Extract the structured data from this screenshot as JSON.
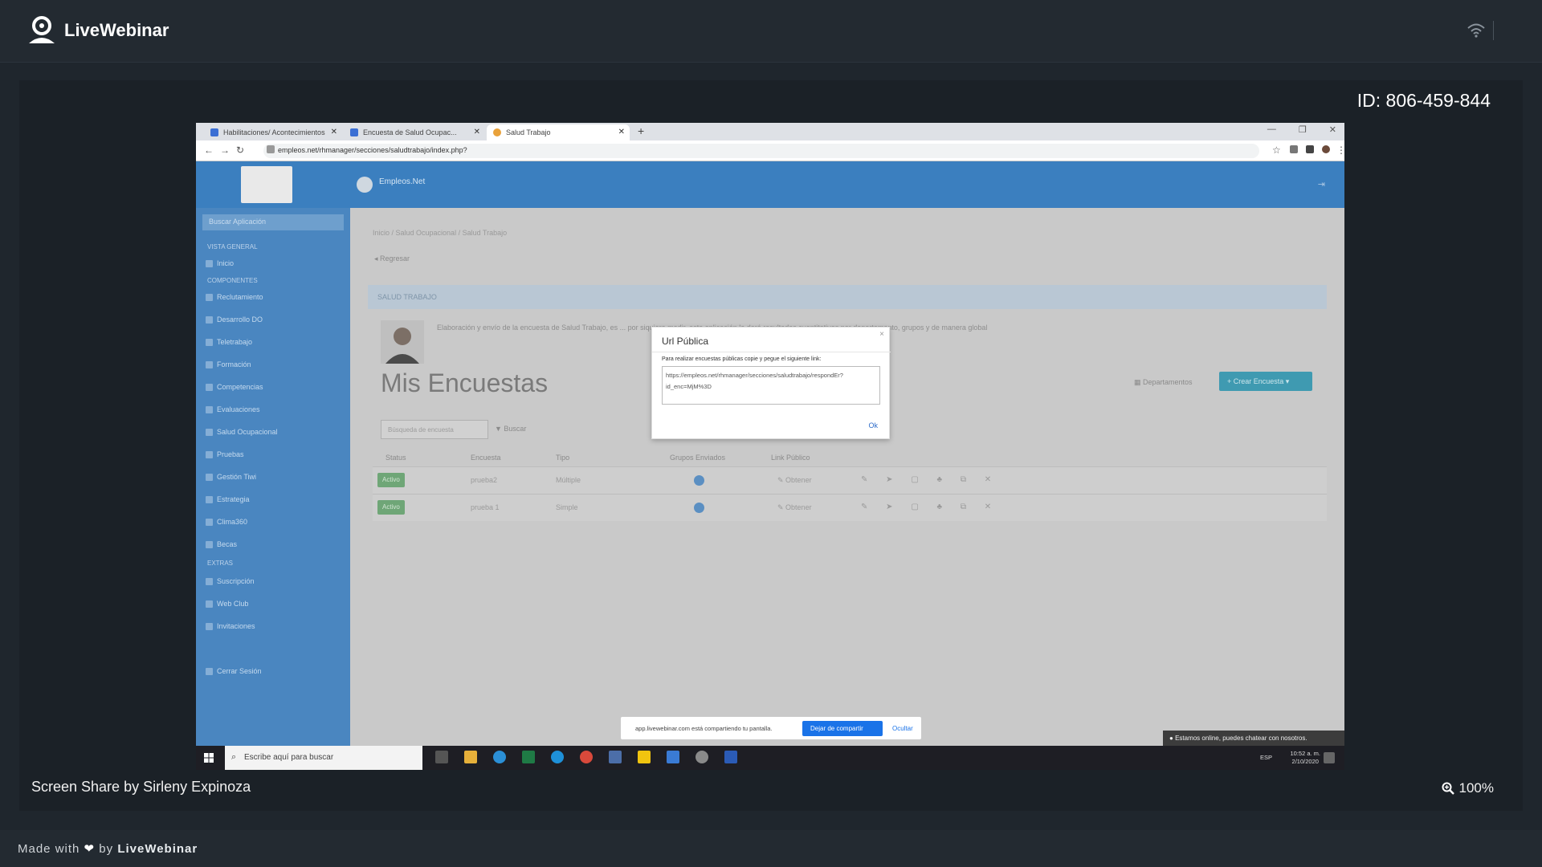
{
  "livewebinar": {
    "brand": "LiveWebinar",
    "meeting_id": "ID: 806-459-844",
    "share_caption": "Screen Share by Sirleny Expinoza",
    "zoom_level": "100%",
    "footer_prefix": "Made with",
    "footer_by": "by",
    "footer_brand": "LiveWebinar"
  },
  "browser": {
    "tabs": [
      {
        "label": "Habilitaciones/ Acontecimientos"
      },
      {
        "label": "Encuesta de Salud Ocupac..."
      },
      {
        "label": "Salud Trabajo"
      }
    ],
    "url": "empleos.net/rhmanager/secciones/saludtrabajo/index.php?"
  },
  "app": {
    "brand": "Empleos.Net",
    "sidebar_search": "Buscar Aplicación",
    "sections": [
      "VISTA GENERAL",
      "COMPONENTES",
      "EXTRAS"
    ],
    "items_general": [
      "Inicio"
    ],
    "items_components": [
      "Reclutamiento",
      "Desarrollo DO",
      "Teletrabajo",
      "Formación",
      "Competencias",
      "Evaluaciones",
      "Salud Ocupacional",
      "Pruebas",
      "Gestión Tiwi",
      "Estrategia",
      "Clima360",
      "Becas"
    ],
    "items_extras": [
      "Suscripción",
      "Web Club",
      "Invitaciones"
    ],
    "logout": "Cerrar Sesión",
    "breadcrumb": "Inicio / Salud Ocupacional / Salud Trabajo",
    "back": "Regresar",
    "panel_title": "SALUD TRABAJO",
    "description": "Elaboración y envío de la encuesta de Salud Trabajo, es ... por siquiera medir, esta aplicación le dará resultados cuantitativos por departamento, grupos y de manera global",
    "page_title": "Mis Encuestas",
    "departments": "Departamentos",
    "create_button": "Crear Encuesta",
    "filter_placeholder": "Búsqueda de encuesta",
    "filter_button": "Buscar",
    "columns": [
      "Status",
      "Encuesta",
      "Tipo",
      "Grupos Enviados",
      "Link Público"
    ],
    "rows": [
      {
        "status": "Activo",
        "name": "prueba2",
        "type": "Múltiple",
        "link": "Obtener"
      },
      {
        "status": "Activo",
        "name": "prueba 1",
        "type": "Simple",
        "link": "Obtener"
      }
    ]
  },
  "modal": {
    "title": "Url Pública",
    "message": "Para realizar encuestas públicas copie y pegue el siguiente link:",
    "url_value": "https://empleos.net/rhmanager/secciones/saludtrabajo/respondEr?id_enc=MjM%3D",
    "ok": "Ok"
  },
  "share_notice": {
    "text": "app.livewebinar.com está compartiendo tu pantalla.",
    "stop": "Dejar de compartir",
    "hide": "Ocultar"
  },
  "chat_notice": "Estamos online, puedes chatear con nosotros.",
  "taskbar": {
    "search_placeholder": "Escribe aquí para buscar",
    "lang": "ESP",
    "time": "10:52 a. m.",
    "date": "2/10/2020"
  }
}
